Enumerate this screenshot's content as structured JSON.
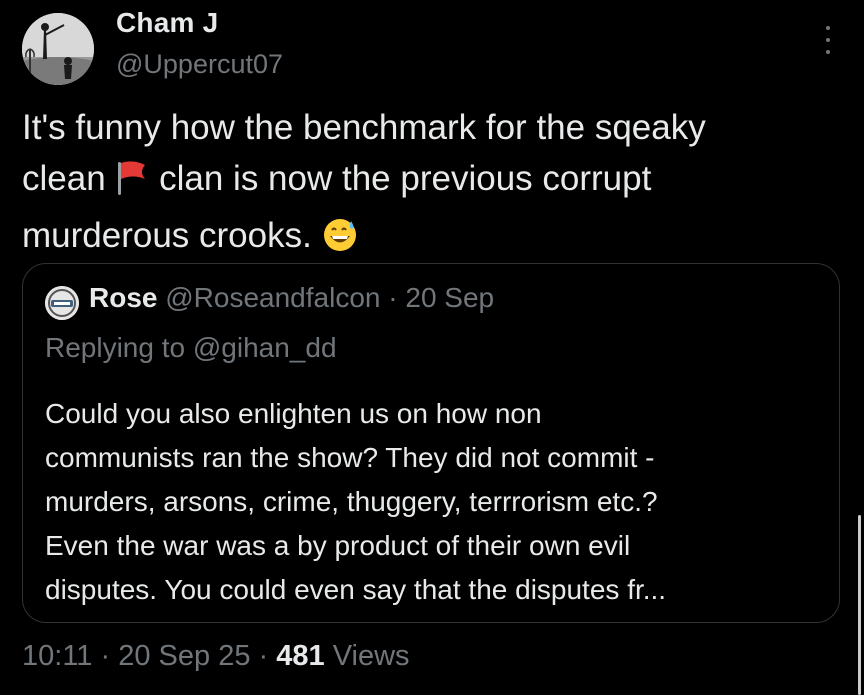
{
  "author": {
    "name": "Cham J",
    "handle": "@Uppercut07"
  },
  "tweet": {
    "line1": "It's funny how the benchmark for the sqeaky",
    "line2_before": "clean ",
    "line2_after": " clan is now the previous corrupt",
    "line3": "murderous crooks.",
    "emoji_flag": "red-flag-icon",
    "emoji_face": "grinning-sweat-icon"
  },
  "quote": {
    "name": "Rose",
    "handle": "@Roseandfalcon",
    "separator": "·",
    "date": "20 Sep",
    "reply_prefix": "Replying to",
    "reply_to": "@gihan_dd",
    "lines": [
      "Could you also enlighten us on how non",
      "communists ran the show? They did not commit -",
      "murders, arsons, crime, thuggery, terrrorism etc.?",
      "Even the war was a by product of their own evil",
      "disputes. You could even say that the disputes fr..."
    ]
  },
  "meta": {
    "time": "10:11",
    "sep1": "·",
    "date": "20 Sep 25",
    "sep2": "·",
    "views_count": "481",
    "views_label": "Views"
  },
  "colors": {
    "background": "#000000",
    "text_primary": "#e7e9ea",
    "text_secondary": "#71767b",
    "border": "#2f3336"
  }
}
